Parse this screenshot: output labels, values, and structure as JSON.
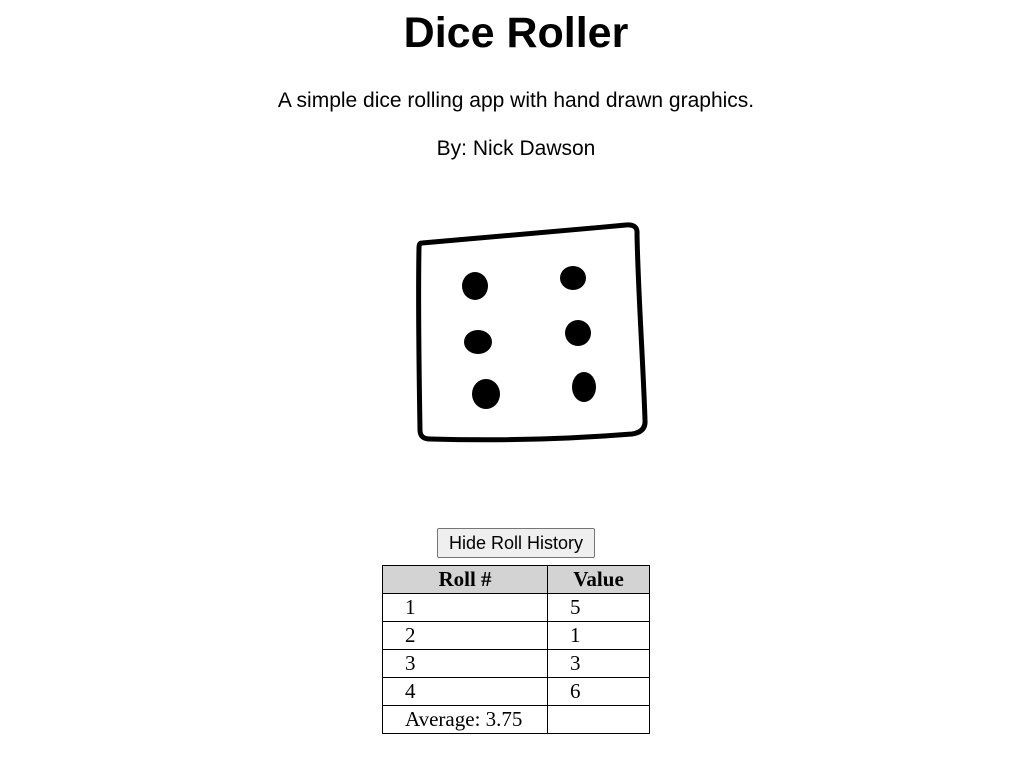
{
  "header": {
    "title": "Dice Roller",
    "subtitle": "A simple dice rolling app with hand drawn graphics.",
    "author": "By: Nick Dawson"
  },
  "dice": {
    "current_value": 6,
    "icon": "hand-drawn-die-six-icon"
  },
  "history": {
    "toggle_label": "Hide Roll History",
    "columns": [
      "Roll #",
      "Value"
    ],
    "rows": [
      {
        "roll": "1",
        "value": "5"
      },
      {
        "roll": "2",
        "value": "1"
      },
      {
        "roll": "3",
        "value": "3"
      },
      {
        "roll": "4",
        "value": "6"
      }
    ],
    "average_label": "Average: 3.75",
    "average_value": ""
  }
}
